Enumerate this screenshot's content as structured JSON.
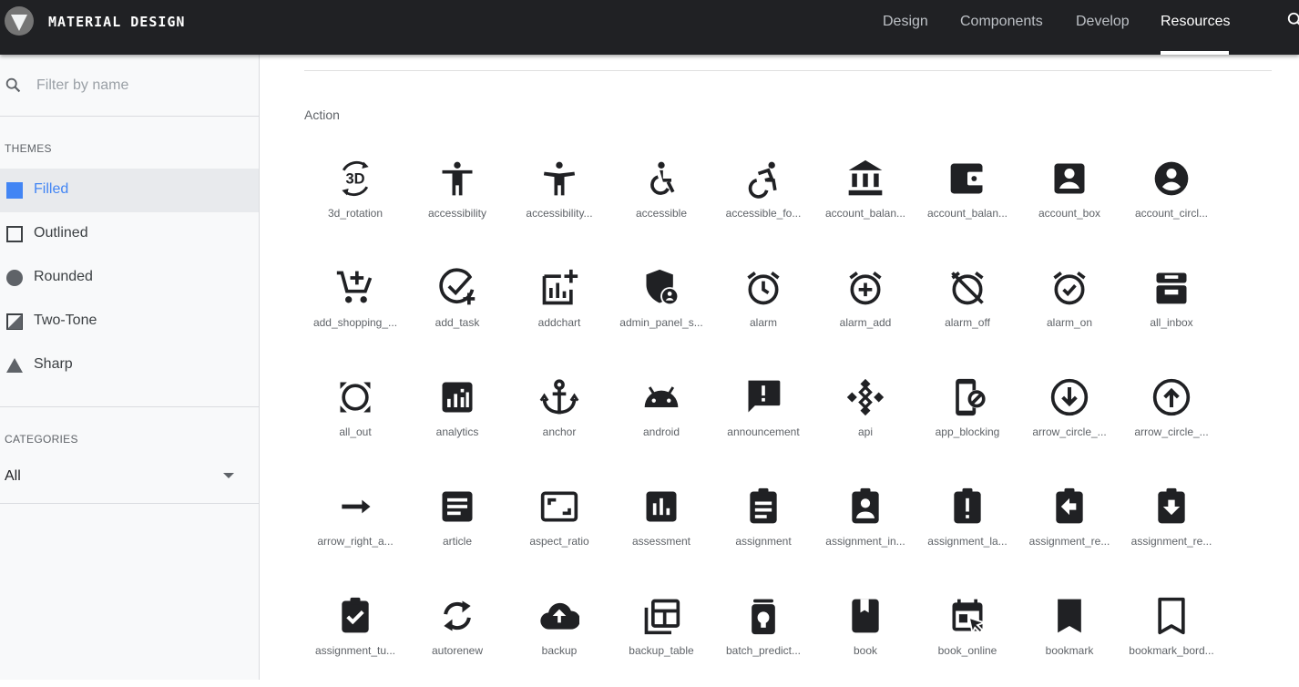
{
  "header": {
    "brand": "MATERIAL DESIGN",
    "nav": [
      "Design",
      "Components",
      "Develop",
      "Resources"
    ],
    "active_nav": "Resources"
  },
  "sidebar": {
    "filter_placeholder": "Filter by name",
    "themes_heading": "THEMES",
    "themes": [
      "Filled",
      "Outlined",
      "Rounded",
      "Two-Tone",
      "Sharp"
    ],
    "active_theme": "Filled",
    "categories_heading": "CATEGORIES",
    "category_value": "All"
  },
  "main": {
    "category_heading": "Action",
    "icons": [
      [
        "3d_rotation",
        "accessibility",
        "accessibility...",
        "accessible",
        "accessible_fo...",
        "account_balan...",
        "account_balan...",
        "account_box",
        "account_circl..."
      ],
      [
        "add_shopping_...",
        "add_task",
        "addchart",
        "admin_panel_s...",
        "alarm",
        "alarm_add",
        "alarm_off",
        "alarm_on",
        "all_inbox"
      ],
      [
        "all_out",
        "analytics",
        "anchor",
        "android",
        "announcement",
        "api",
        "app_blocking",
        "arrow_circle_...",
        "arrow_circle_..."
      ],
      [
        "arrow_right_a...",
        "article",
        "aspect_ratio",
        "assessment",
        "assignment",
        "assignment_in...",
        "assignment_la...",
        "assignment_re...",
        "assignment_re..."
      ],
      [
        "assignment_tu...",
        "autorenew",
        "backup",
        "backup_table",
        "batch_predict...",
        "book",
        "book_online",
        "bookmark",
        "bookmark_bord..."
      ]
    ]
  },
  "colors": {
    "topbar": "#202124",
    "accent": "#4285f4",
    "icon": "#202124"
  }
}
